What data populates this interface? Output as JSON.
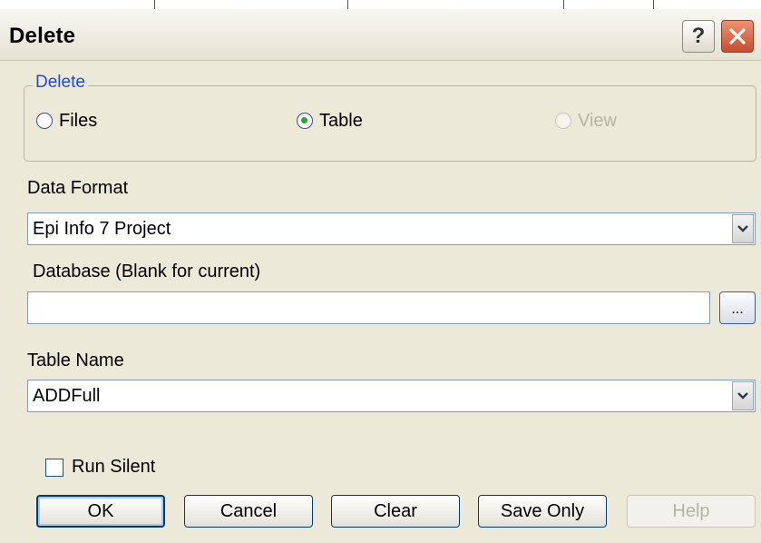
{
  "window": {
    "title": "Delete"
  },
  "title_buttons": {
    "help_icon": "help-icon",
    "close_icon": "close-icon"
  },
  "delete_group": {
    "legend": "Delete",
    "options": [
      {
        "label": "Files",
        "selected": false,
        "enabled": true
      },
      {
        "label": "Table",
        "selected": true,
        "enabled": true
      },
      {
        "label": "View",
        "selected": false,
        "enabled": false
      }
    ]
  },
  "data_format": {
    "label": "Data Format",
    "value": "Epi Info 7 Project"
  },
  "database": {
    "label": "Database (Blank for current)",
    "value": "",
    "browse_label": "..."
  },
  "table_name": {
    "label": "Table Name",
    "value": "ADDFull"
  },
  "run_silent": {
    "label": "Run Silent",
    "checked": false
  },
  "buttons": {
    "ok": "OK",
    "cancel": "Cancel",
    "clear": "Clear",
    "save_only": "Save Only",
    "help": "Help"
  },
  "colors": {
    "dialog_bg": "#ece9d8",
    "legend_text": "#1d4bd6",
    "radio_selected": "#2fa22f",
    "close_button": "#c74d2f"
  }
}
